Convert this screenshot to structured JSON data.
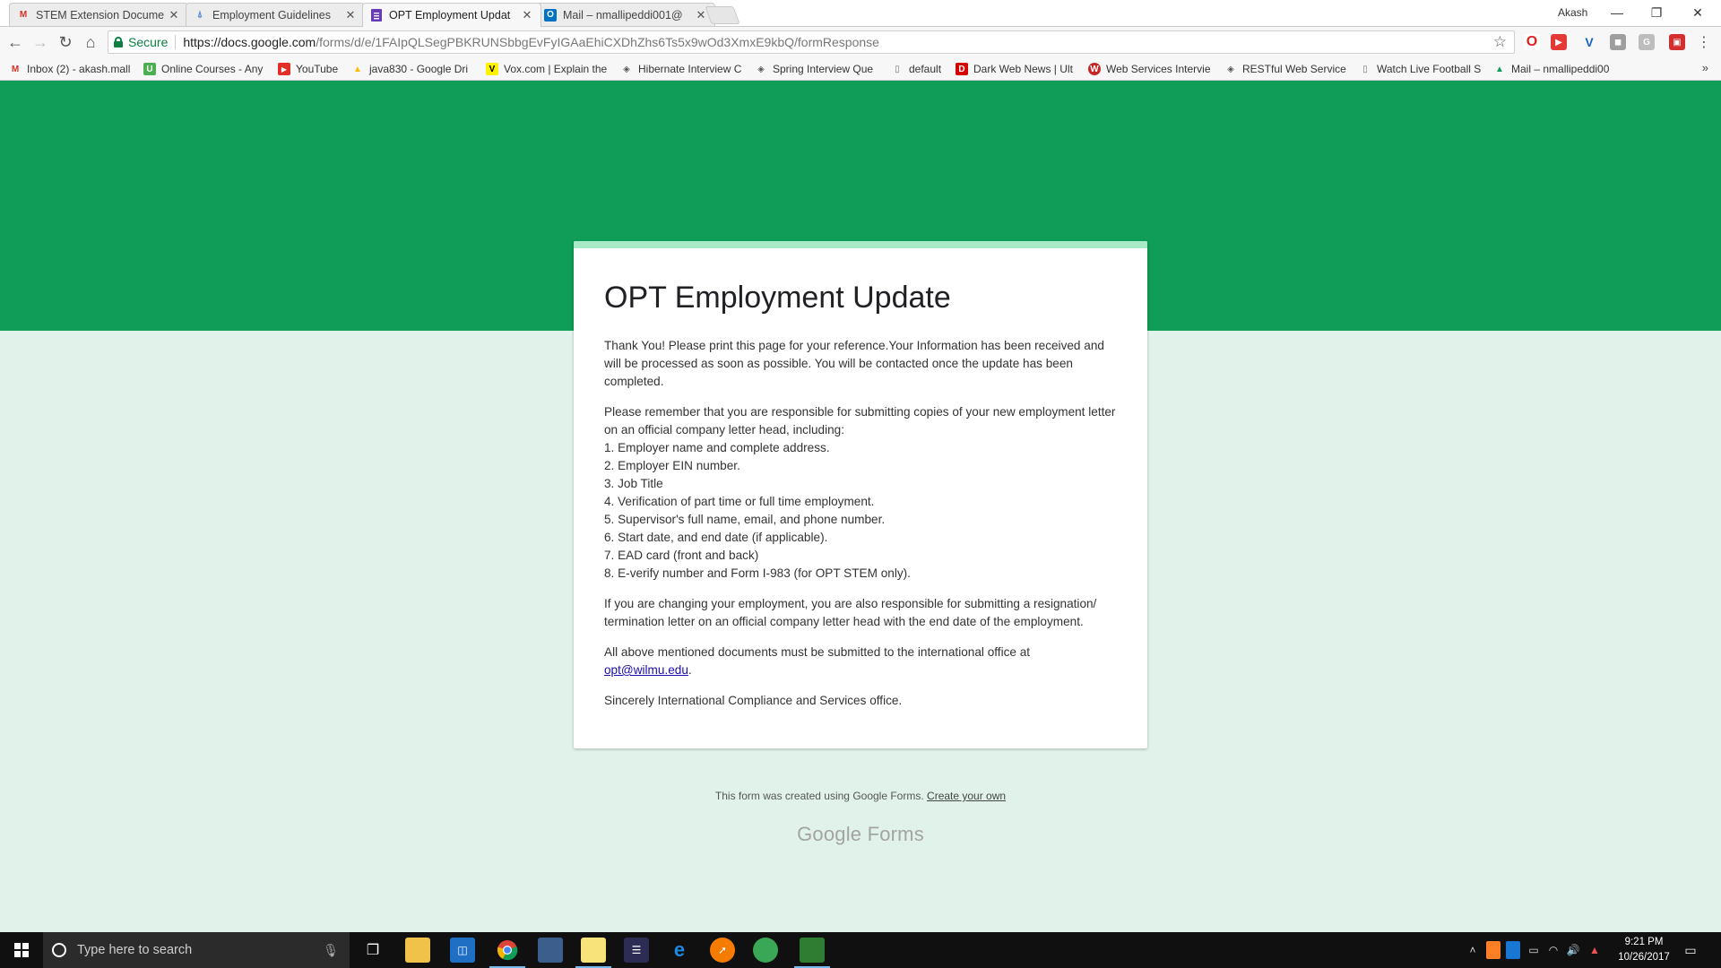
{
  "browser": {
    "tabs": [
      {
        "title": "STEM Extension Docume",
        "icon": "gmail-icon",
        "active": false
      },
      {
        "title": "Employment Guidelines",
        "icon": "document-icon",
        "active": false
      },
      {
        "title": "OPT Employment Updat",
        "icon": "google-forms-icon",
        "active": true
      },
      {
        "title": "Mail – nmallipeddi001@",
        "icon": "outlook-icon",
        "active": false
      }
    ],
    "profile_name": "Akash",
    "secure_label": "Secure",
    "url_host": "https://docs.google.com",
    "url_path": "/forms/d/e/1FAIpQLSegPBKRUNSbbgEvFyIGAaEhiCXDhZhs6Ts5x9wOd3XmxE9kbQ/formResponse",
    "bookmarks": [
      {
        "label": "Inbox (2) - akash.mall",
        "icon": "gmail-icon"
      },
      {
        "label": "Online Courses - Any",
        "icon": "udemy-icon"
      },
      {
        "label": "YouTube",
        "icon": "youtube-icon"
      },
      {
        "label": "java830 - Google Dri",
        "icon": "drive-icon"
      },
      {
        "label": "Vox.com | Explain the",
        "icon": "vox-icon"
      },
      {
        "label": "Hibernate Interview C",
        "icon": "diamond-icon"
      },
      {
        "label": "Spring Interview Que",
        "icon": "diamond-icon"
      },
      {
        "label": "default",
        "icon": "page-icon"
      },
      {
        "label": "Dark Web News | Ult",
        "icon": "darkweb-icon"
      },
      {
        "label": "Web Services Intervie",
        "icon": "webservices-icon"
      },
      {
        "label": "RESTful Web Services",
        "icon": "diamond-icon"
      },
      {
        "label": "Watch Live Football S",
        "icon": "page-icon"
      },
      {
        "label": "Mail – nmallipeddi00",
        "icon": "mail-icon"
      }
    ],
    "bookmarks_more": "»"
  },
  "form": {
    "title": "OPT Employment Update",
    "paragraph1": "Thank You! Please print this page for your reference.Your Information has been received and will be processed as soon as possible. You will be contacted once the update has been completed.",
    "paragraph2_intro": "Please remember that you are responsible for submitting copies of your new employment letter on an official company letter head, including:",
    "requirements": [
      "1. Employer name and complete address.",
      "2. Employer EIN number.",
      "3. Job Title",
      "4. Verification of part time or full time employment.",
      "5. Supervisor's full name, email, and phone number.",
      "6. Start date, and end date (if applicable).",
      "7. EAD card (front and back)",
      "8. E-verify number and Form I-983 (for OPT STEM only)."
    ],
    "paragraph3": "If you are changing your employment, you are also responsible for submitting a resignation/ termination letter on an official company letter head with the end date of the employment.",
    "paragraph4_prefix": "All above mentioned documents must be submitted to the international office at",
    "email_link": "opt@wilmu.edu",
    "paragraph4_suffix": ".",
    "paragraph5": "Sincerely International Compliance and Services office."
  },
  "footer": {
    "note": "This form was created using Google Forms.",
    "create_link": "Create your own",
    "brand_google": "Google",
    "brand_forms": "Forms"
  },
  "taskbar": {
    "search_placeholder": "Type here to search",
    "time": "9:21 PM",
    "date": "10/26/2017"
  },
  "colors": {
    "banner": "#0f9d58",
    "page_background": "#e0f2ea",
    "card_accent": "#a7ebc6",
    "secure_green": "#0b8043"
  }
}
